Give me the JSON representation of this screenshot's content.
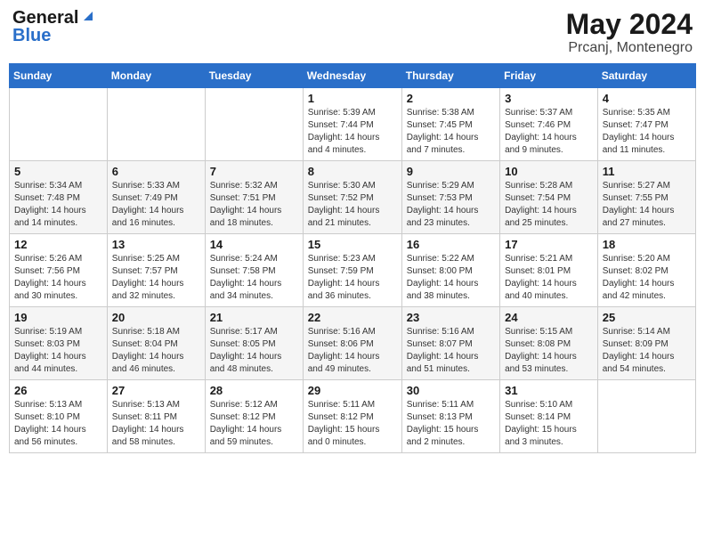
{
  "logo": {
    "general": "General",
    "blue": "Blue"
  },
  "title": {
    "month": "May 2024",
    "location": "Prcanj, Montenegro"
  },
  "weekdays": [
    "Sunday",
    "Monday",
    "Tuesday",
    "Wednesday",
    "Thursday",
    "Friday",
    "Saturday"
  ],
  "weeks": [
    [
      {
        "day": "",
        "info": ""
      },
      {
        "day": "",
        "info": ""
      },
      {
        "day": "",
        "info": ""
      },
      {
        "day": "1",
        "info": "Sunrise: 5:39 AM\nSunset: 7:44 PM\nDaylight: 14 hours\nand 4 minutes."
      },
      {
        "day": "2",
        "info": "Sunrise: 5:38 AM\nSunset: 7:45 PM\nDaylight: 14 hours\nand 7 minutes."
      },
      {
        "day": "3",
        "info": "Sunrise: 5:37 AM\nSunset: 7:46 PM\nDaylight: 14 hours\nand 9 minutes."
      },
      {
        "day": "4",
        "info": "Sunrise: 5:35 AM\nSunset: 7:47 PM\nDaylight: 14 hours\nand 11 minutes."
      }
    ],
    [
      {
        "day": "5",
        "info": "Sunrise: 5:34 AM\nSunset: 7:48 PM\nDaylight: 14 hours\nand 14 minutes."
      },
      {
        "day": "6",
        "info": "Sunrise: 5:33 AM\nSunset: 7:49 PM\nDaylight: 14 hours\nand 16 minutes."
      },
      {
        "day": "7",
        "info": "Sunrise: 5:32 AM\nSunset: 7:51 PM\nDaylight: 14 hours\nand 18 minutes."
      },
      {
        "day": "8",
        "info": "Sunrise: 5:30 AM\nSunset: 7:52 PM\nDaylight: 14 hours\nand 21 minutes."
      },
      {
        "day": "9",
        "info": "Sunrise: 5:29 AM\nSunset: 7:53 PM\nDaylight: 14 hours\nand 23 minutes."
      },
      {
        "day": "10",
        "info": "Sunrise: 5:28 AM\nSunset: 7:54 PM\nDaylight: 14 hours\nand 25 minutes."
      },
      {
        "day": "11",
        "info": "Sunrise: 5:27 AM\nSunset: 7:55 PM\nDaylight: 14 hours\nand 27 minutes."
      }
    ],
    [
      {
        "day": "12",
        "info": "Sunrise: 5:26 AM\nSunset: 7:56 PM\nDaylight: 14 hours\nand 30 minutes."
      },
      {
        "day": "13",
        "info": "Sunrise: 5:25 AM\nSunset: 7:57 PM\nDaylight: 14 hours\nand 32 minutes."
      },
      {
        "day": "14",
        "info": "Sunrise: 5:24 AM\nSunset: 7:58 PM\nDaylight: 14 hours\nand 34 minutes."
      },
      {
        "day": "15",
        "info": "Sunrise: 5:23 AM\nSunset: 7:59 PM\nDaylight: 14 hours\nand 36 minutes."
      },
      {
        "day": "16",
        "info": "Sunrise: 5:22 AM\nSunset: 8:00 PM\nDaylight: 14 hours\nand 38 minutes."
      },
      {
        "day": "17",
        "info": "Sunrise: 5:21 AM\nSunset: 8:01 PM\nDaylight: 14 hours\nand 40 minutes."
      },
      {
        "day": "18",
        "info": "Sunrise: 5:20 AM\nSunset: 8:02 PM\nDaylight: 14 hours\nand 42 minutes."
      }
    ],
    [
      {
        "day": "19",
        "info": "Sunrise: 5:19 AM\nSunset: 8:03 PM\nDaylight: 14 hours\nand 44 minutes."
      },
      {
        "day": "20",
        "info": "Sunrise: 5:18 AM\nSunset: 8:04 PM\nDaylight: 14 hours\nand 46 minutes."
      },
      {
        "day": "21",
        "info": "Sunrise: 5:17 AM\nSunset: 8:05 PM\nDaylight: 14 hours\nand 48 minutes."
      },
      {
        "day": "22",
        "info": "Sunrise: 5:16 AM\nSunset: 8:06 PM\nDaylight: 14 hours\nand 49 minutes."
      },
      {
        "day": "23",
        "info": "Sunrise: 5:16 AM\nSunset: 8:07 PM\nDaylight: 14 hours\nand 51 minutes."
      },
      {
        "day": "24",
        "info": "Sunrise: 5:15 AM\nSunset: 8:08 PM\nDaylight: 14 hours\nand 53 minutes."
      },
      {
        "day": "25",
        "info": "Sunrise: 5:14 AM\nSunset: 8:09 PM\nDaylight: 14 hours\nand 54 minutes."
      }
    ],
    [
      {
        "day": "26",
        "info": "Sunrise: 5:13 AM\nSunset: 8:10 PM\nDaylight: 14 hours\nand 56 minutes."
      },
      {
        "day": "27",
        "info": "Sunrise: 5:13 AM\nSunset: 8:11 PM\nDaylight: 14 hours\nand 58 minutes."
      },
      {
        "day": "28",
        "info": "Sunrise: 5:12 AM\nSunset: 8:12 PM\nDaylight: 14 hours\nand 59 minutes."
      },
      {
        "day": "29",
        "info": "Sunrise: 5:11 AM\nSunset: 8:12 PM\nDaylight: 15 hours\nand 0 minutes."
      },
      {
        "day": "30",
        "info": "Sunrise: 5:11 AM\nSunset: 8:13 PM\nDaylight: 15 hours\nand 2 minutes."
      },
      {
        "day": "31",
        "info": "Sunrise: 5:10 AM\nSunset: 8:14 PM\nDaylight: 15 hours\nand 3 minutes."
      },
      {
        "day": "",
        "info": ""
      }
    ]
  ]
}
